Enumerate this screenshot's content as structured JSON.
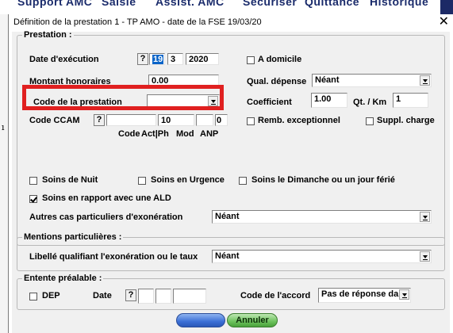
{
  "background": {
    "menu": [
      "Support AMC",
      "Saisie",
      "Assist. AMC",
      "Sécuriser",
      "Quittance",
      "Historique"
    ]
  },
  "dialog": {
    "title": "Définition de la prestation 1 - TP AMO - date de la FSE 19/03/20",
    "close": "✕"
  },
  "prestation": {
    "legend": "Prestation :",
    "date_label": "Date d'exécution",
    "help": "?",
    "day": "19",
    "month": "3",
    "year": "2020",
    "a_domicile": "A domicile",
    "montant_label": "Montant honoraires",
    "montant_value": "0.00",
    "qual_depense_label": "Qual. dépense",
    "qual_depense_value": "Néant",
    "code_prestation_label": "Code de la prestation",
    "code_prestation_value": "",
    "coefficient_label": "Coefficient",
    "coefficient_value": "1.00",
    "qt_km_label": "Qt. / Km",
    "qt_km_value": "1",
    "ccam_label": "Code CCAM",
    "ccam_code_value": "",
    "ccam_actph_value": "10",
    "ccam_mod_value": "",
    "ccam_anp_value": "0",
    "ccam_sub_code": "Code",
    "ccam_sub_actph": "Act|Ph",
    "ccam_sub_mod": "Mod",
    "ccam_sub_anp": "ANP",
    "remb_exceptionnel": "Remb. exceptionnel",
    "suppl_charge": "Suppl. charge",
    "soins_nuit": "Soins de Nuit",
    "soins_urgence": "Soins en Urgence",
    "soins_dimanche": "Soins le Dimanche ou un jour férié",
    "soins_ald": "Soins en rapport avec une ALD",
    "soins_ald_checked": true,
    "autres_cas_label": "Autres cas particuliers d'exonération",
    "autres_cas_value": "Néant"
  },
  "mentions": {
    "legend": "Mentions particulières :",
    "libelle_label": "Libellé qualifiant l'exonération ou le taux",
    "libelle_value": "Néant"
  },
  "entente": {
    "legend": "Entente préalable :",
    "dep": "DEP",
    "date_label": "Date",
    "help": "?",
    "code_accord_label": "Code de l'accord",
    "code_accord_value": "Pas de réponse dans"
  },
  "buttons": {
    "ok": "",
    "annuler": "Annuler"
  },
  "colors": {
    "highlight_box": "#e02020",
    "selection": "#0a64c8"
  }
}
